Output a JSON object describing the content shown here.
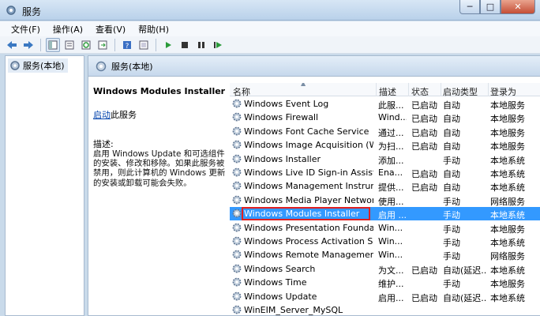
{
  "window": {
    "title": "服务"
  },
  "title_buttons": {
    "minimize": "─",
    "maximize": "□",
    "close": "✕"
  },
  "menu": [
    "文件(F)",
    "操作(A)",
    "查看(V)",
    "帮助(H)"
  ],
  "toolbar_icons": [
    "back-arrow-icon",
    "forward-arrow-icon",
    "console-tree-icon",
    "properties-icon",
    "refresh-icon",
    "export-icon",
    "help-icon",
    "console-icon",
    "play-icon",
    "stop-icon",
    "pause-icon",
    "restart-icon"
  ],
  "tree": {
    "root_label": "服务(本地)"
  },
  "pane_header": {
    "title": "服务(本地)"
  },
  "detail": {
    "service_name": "Windows Modules Installer",
    "start_link": "启动",
    "start_suffix": "此服务",
    "description_label": "描述:",
    "description_text": "启用 Windows Update 和可选组件\n的安装、修改和移除。如果此服务被\n禁用，则此计算机的 Windows 更新\n的安装或卸载可能会失败。"
  },
  "columns": {
    "name": "名称",
    "description": "描述",
    "status": "状态",
    "startup": "启动类型",
    "logon": "登录为"
  },
  "services": [
    {
      "name": "Windows Event Log",
      "description": "此服...",
      "status": "已启动",
      "startup": "自动",
      "logon": "本地服务"
    },
    {
      "name": "Windows Firewall",
      "description": "Wind...",
      "status": "已启动",
      "startup": "自动",
      "logon": "本地服务"
    },
    {
      "name": "Windows Font Cache Service",
      "description": "通过...",
      "status": "已启动",
      "startup": "自动",
      "logon": "本地服务"
    },
    {
      "name": "Windows Image Acquisition (WIA)",
      "description": "为扫...",
      "status": "已启动",
      "startup": "自动",
      "logon": "本地服务"
    },
    {
      "name": "Windows Installer",
      "description": "添加...",
      "status": "",
      "startup": "手动",
      "logon": "本地系统"
    },
    {
      "name": "Windows Live ID Sign-in Assistant",
      "description": "Ena...",
      "status": "已启动",
      "startup": "自动",
      "logon": "本地系统"
    },
    {
      "name": "Windows Management Instrum...",
      "description": "提供...",
      "status": "已启动",
      "startup": "自动",
      "logon": "本地系统"
    },
    {
      "name": "Windows Media Player Network...",
      "description": "使用...",
      "status": "",
      "startup": "手动",
      "logon": "网络服务"
    },
    {
      "name": "Windows Modules Installer",
      "description": "启用 ...",
      "status": "",
      "startup": "手动",
      "logon": "本地系统",
      "selected": true
    },
    {
      "name": "Windows Presentation Foundati...",
      "description": "Win...",
      "status": "",
      "startup": "手动",
      "logon": "本地服务"
    },
    {
      "name": "Windows Process Activation Ser...",
      "description": "Win...",
      "status": "",
      "startup": "手动",
      "logon": "本地系统"
    },
    {
      "name": "Windows Remote Management ...",
      "description": "Win...",
      "status": "",
      "startup": "手动",
      "logon": "网络服务"
    },
    {
      "name": "Windows Search",
      "description": "为文...",
      "status": "已启动",
      "startup": "自动(延迟...",
      "logon": "本地系统"
    },
    {
      "name": "Windows Time",
      "description": "维护...",
      "status": "",
      "startup": "手动",
      "logon": "本地服务"
    },
    {
      "name": "Windows Update",
      "description": "启用...",
      "status": "已启动",
      "startup": "自动(延迟...",
      "logon": "本地系统"
    },
    {
      "name": "WinEIM_Server_MySQL",
      "description": "",
      "status": "",
      "startup": "",
      "logon": ""
    }
  ],
  "colors": {
    "selection": "#3399ff",
    "highlight_box": "#e02020",
    "link": "#0645ad"
  }
}
